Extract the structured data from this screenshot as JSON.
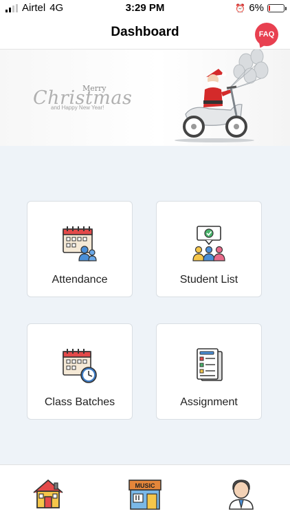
{
  "status_bar": {
    "carrier": "Airtel",
    "network": "4G",
    "time": "3:29 PM",
    "battery_percent": "6%",
    "battery_level": 0.06,
    "battery_color": "#e02020"
  },
  "nav": {
    "title": "Dashboard",
    "faq_label": "FAQ",
    "faq_color": "#e84050"
  },
  "banner": {
    "merry": "Merry",
    "christmas": "Christmas",
    "new_year": "and Happy New Year!"
  },
  "tiles": [
    {
      "label": "Attendance",
      "icon": "attendance-icon"
    },
    {
      "label": "Student List",
      "icon": "student-list-icon"
    },
    {
      "label": "Class Batches",
      "icon": "class-batches-icon"
    },
    {
      "label": "Assignment",
      "icon": "assignment-icon"
    }
  ],
  "tab_bar": {
    "items": [
      {
        "icon": "home-icon"
      },
      {
        "icon": "music-store-icon",
        "sign": "MUSIC"
      },
      {
        "icon": "profile-icon"
      }
    ]
  },
  "colors": {
    "background": "#eef3f8",
    "accent": "#e84050"
  }
}
